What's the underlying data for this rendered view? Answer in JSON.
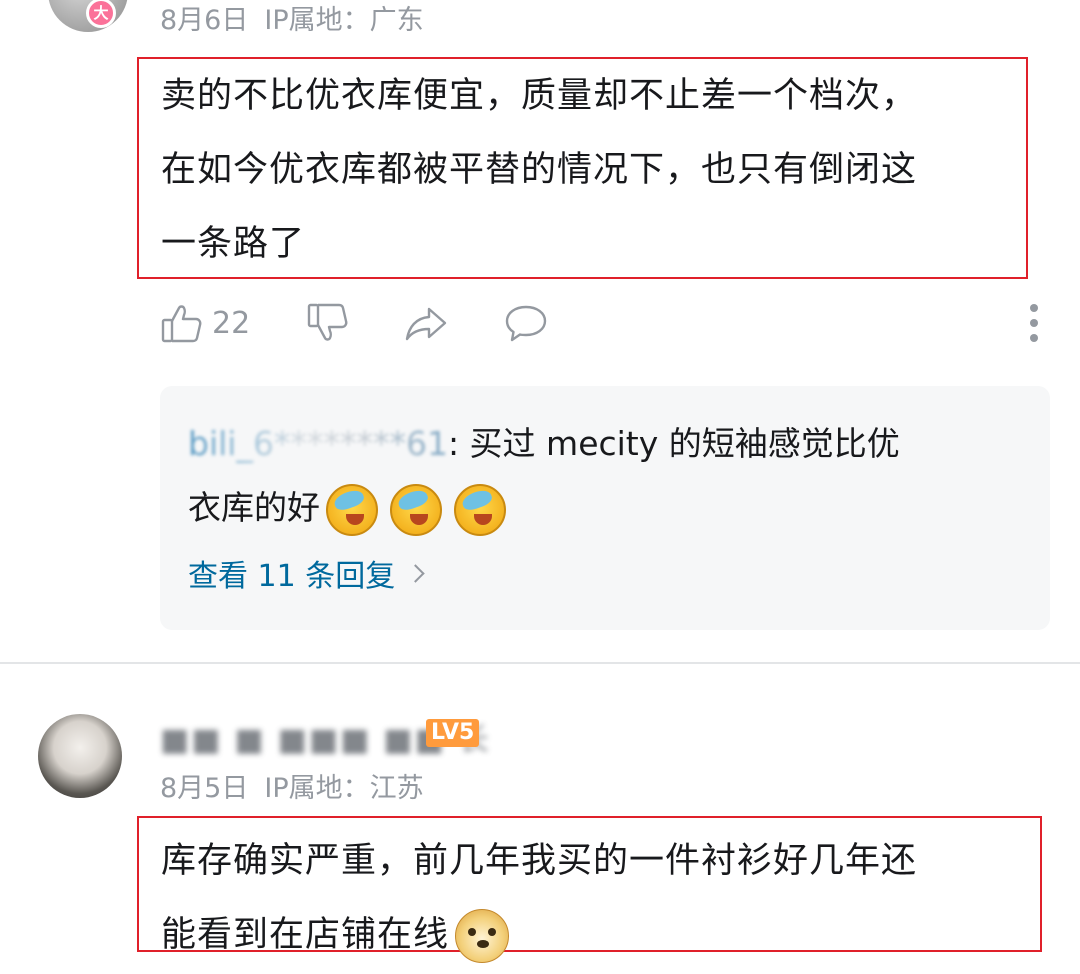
{
  "comment1": {
    "vip_badge": "大",
    "date": "8月6日",
    "ip_location": "IP属地：广东",
    "text_lines": [
      "卖的不比优衣库便宜，质量却不止差一个档次，",
      "在如今优衣库都被平替的情况下，也只有倒闭这",
      "一条路了"
    ],
    "like_count": "22",
    "reply_preview": {
      "user": "bili_6********61",
      "text_line1": ": 买过 mecity 的短袖感觉比优",
      "text_line2": "衣库的好",
      "view_replies": "查看 11 条回复"
    }
  },
  "comment2": {
    "username": "■■ ■ ■■■ ■■ 长",
    "level_badge": "LV5",
    "date": "8月5日",
    "ip_location": "IP属地：江苏",
    "text_lines": [
      "库存确实严重，前几年我买的一件衬衫好几年还",
      "能看到在店铺在线"
    ]
  },
  "colors": {
    "highlight_border": "#e0202a",
    "link_blue": "#00699d",
    "meta_gray": "#9499a0",
    "level_orange": "#ff9b3d",
    "vip_pink": "#fb7299"
  },
  "icons": [
    "thumb-up-icon",
    "thumb-down-icon",
    "share-icon",
    "comment-icon",
    "more-icon",
    "chevron-right-icon",
    "laughing-emoji-icon",
    "doge-emoji-icon"
  ]
}
